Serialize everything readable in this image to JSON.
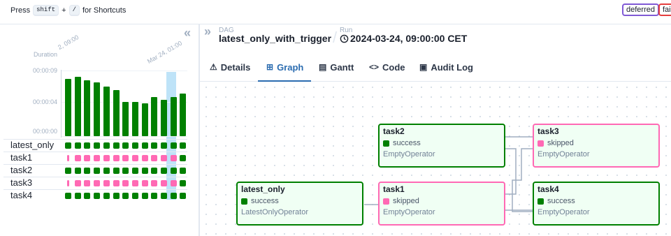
{
  "topbar": {
    "press": "Press",
    "key1": "shift",
    "plus": "+",
    "key2": "/",
    "for_shortcuts": "for Shortcuts",
    "legend": [
      {
        "label": "deferred",
        "color": "#805ad5"
      },
      {
        "label": "fail",
        "color": "#e53e3e"
      }
    ]
  },
  "grid": {
    "collapse_icon": "«",
    "duration_label": "Duration",
    "date_labels": [
      "2, 09:00",
      "Mar 24, 01:00"
    ],
    "y_ticks": [
      "00:00:09",
      "00:00:04",
      "00:00:00"
    ],
    "durations_fraction": [
      0.87,
      0.9,
      0.85,
      0.82,
      0.75,
      0.7,
      0.52,
      0.52,
      0.5,
      0.6,
      0.55,
      0.6,
      0.65
    ],
    "highlight_index": 11,
    "rows": [
      {
        "label": "latest_only",
        "states": [
          "s",
          "s",
          "s",
          "s",
          "s",
          "s",
          "s",
          "s",
          "s",
          "s",
          "s",
          "s",
          "s"
        ]
      },
      {
        "label": "task1",
        "states": [
          "p",
          "k",
          "k",
          "k",
          "k",
          "k",
          "k",
          "k",
          "k",
          "k",
          "k",
          "k",
          "s"
        ]
      },
      {
        "label": "task2",
        "states": [
          "s",
          "s",
          "s",
          "s",
          "s",
          "s",
          "s",
          "s",
          "s",
          "s",
          "s",
          "s",
          "s"
        ]
      },
      {
        "label": "task3",
        "states": [
          "p",
          "k",
          "k",
          "k",
          "k",
          "k",
          "k",
          "k",
          "k",
          "k",
          "k",
          "k",
          "s"
        ]
      },
      {
        "label": "task4",
        "states": [
          "s",
          "s",
          "s",
          "s",
          "s",
          "s",
          "s",
          "s",
          "s",
          "s",
          "s",
          "s",
          "s"
        ]
      }
    ],
    "state_colors": {
      "success": "#008000",
      "skipped": "#ff69b4"
    }
  },
  "breadcrumb": {
    "expand_icon": "»",
    "dag_label": "DAG",
    "dag_name": "latest_only_with_trigger",
    "run_label": "Run",
    "clock_icon": "clock-icon",
    "run_value": "2024-03-24, 09:00:00 CET"
  },
  "tabs": [
    {
      "label": "Details",
      "icon": "⚠"
    },
    {
      "label": "Graph",
      "icon": "⊞"
    },
    {
      "label": "Gantt",
      "icon": "▤"
    },
    {
      "label": "Code",
      "icon": "<>"
    },
    {
      "label": "Audit Log",
      "icon": "▣"
    }
  ],
  "active_tab": "Graph",
  "graph": {
    "nodes": [
      {
        "id": "task2",
        "name": "task2",
        "state": "success",
        "operator": "EmptyOperator",
        "color": "#008000",
        "dot": "#008000"
      },
      {
        "id": "task3",
        "name": "task3",
        "state": "skipped",
        "operator": "EmptyOperator",
        "color": "#ff69b4",
        "dot": "#ff69b4"
      },
      {
        "id": "latest_only",
        "name": "latest_only",
        "state": "success",
        "operator": "LatestOnlyOperator",
        "color": "#008000",
        "dot": "#008000"
      },
      {
        "id": "task1",
        "name": "task1",
        "state": "skipped",
        "operator": "EmptyOperator",
        "color": "#ff69b4",
        "dot": "#ff69b4"
      },
      {
        "id": "task4",
        "name": "task4",
        "state": "success",
        "operator": "EmptyOperator",
        "color": "#008000",
        "dot": "#008000"
      }
    ]
  }
}
